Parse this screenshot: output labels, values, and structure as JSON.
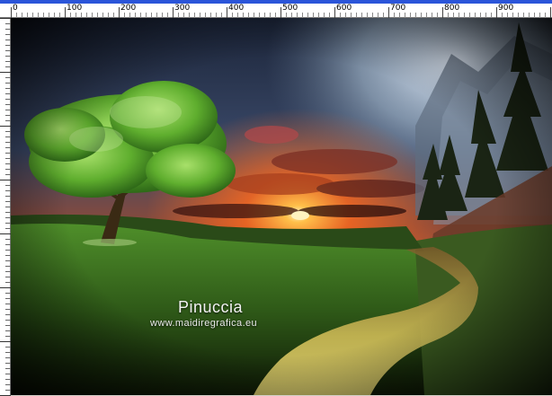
{
  "ruler": {
    "labels": [
      "0",
      "100",
      "200",
      "300",
      "400",
      "500",
      "600",
      "700",
      "800",
      "900"
    ]
  },
  "artwork": {
    "title": "Pinuccia",
    "url": "www.maidiregrafica.eu"
  },
  "colors": {
    "ruler_bar": "#2b55d9",
    "sky_top": "#1b2a4a",
    "sunset": "#ff7a1a",
    "grass": "#3f7a1f",
    "tree": "#6fbf3a"
  }
}
